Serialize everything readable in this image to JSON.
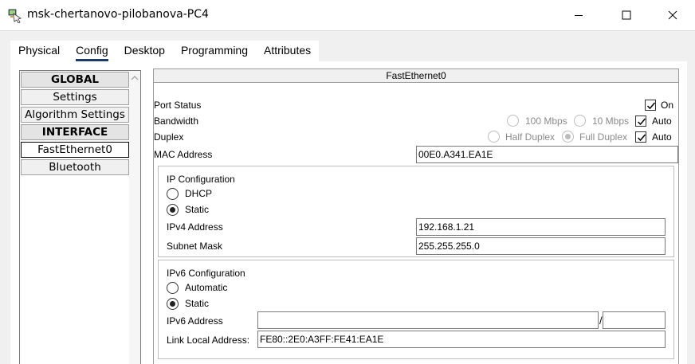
{
  "window": {
    "title": "msk-chertanovo-pilobanova-PC4",
    "minimize_glyph": "—",
    "maximize_glyph": "☐",
    "close_glyph": "✕"
  },
  "tabs": [
    {
      "label": "Physical"
    },
    {
      "label": "Config",
      "active": true
    },
    {
      "label": "Desktop"
    },
    {
      "label": "Programming"
    },
    {
      "label": "Attributes"
    }
  ],
  "left_list": {
    "items": [
      {
        "label": "GLOBAL",
        "type": "header"
      },
      {
        "label": "Settings",
        "type": "item"
      },
      {
        "label": "Algorithm Settings",
        "type": "item"
      },
      {
        "label": "INTERFACE",
        "type": "header"
      },
      {
        "label": "FastEthernet0",
        "type": "item",
        "selected": true
      },
      {
        "label": "Bluetooth",
        "type": "item"
      }
    ]
  },
  "interface": {
    "title": "FastEthernet0",
    "port_status_label": "Port Status",
    "port_on_label": "On",
    "port_on_checked": true,
    "bandwidth_label": "Bandwidth",
    "bandwidth_100_label": "100 Mbps",
    "bandwidth_10_label": "10 Mbps",
    "bandwidth_auto_label": "Auto",
    "bandwidth_auto_checked": true,
    "duplex_label": "Duplex",
    "duplex_half_label": "Half Duplex",
    "duplex_full_label": "Full Duplex",
    "duplex_auto_label": "Auto",
    "duplex_auto_checked": true,
    "mac_label": "MAC Address",
    "mac_value": "00E0.A341.EA1E"
  },
  "ipv4": {
    "section_label": "IP Configuration",
    "dhcp_label": "DHCP",
    "static_label": "Static",
    "selected": "Static",
    "address_label": "IPv4 Address",
    "address_value": "192.168.1.21",
    "mask_label": "Subnet Mask",
    "mask_value": "255.255.255.0"
  },
  "ipv6": {
    "section_label": "IPv6 Configuration",
    "automatic_label": "Automatic",
    "static_label": "Static",
    "selected": "Static",
    "address_label": "IPv6 Address",
    "address_value": "",
    "prefix_separator": "/",
    "prefix_value": "",
    "link_local_label": "Link Local Address:",
    "link_local_value": "FE80::2E0:A3FF:FE41:EA1E"
  },
  "icons": {
    "app": "packet-tracer-pc-icon",
    "checkmark": "checkmark-icon",
    "scroll_up": "chevron-up-icon"
  },
  "colors": {
    "tab_underline": "#1d3b6a",
    "window_bg": "#f0f0f0",
    "disabled_text": "#8a8a8a"
  }
}
